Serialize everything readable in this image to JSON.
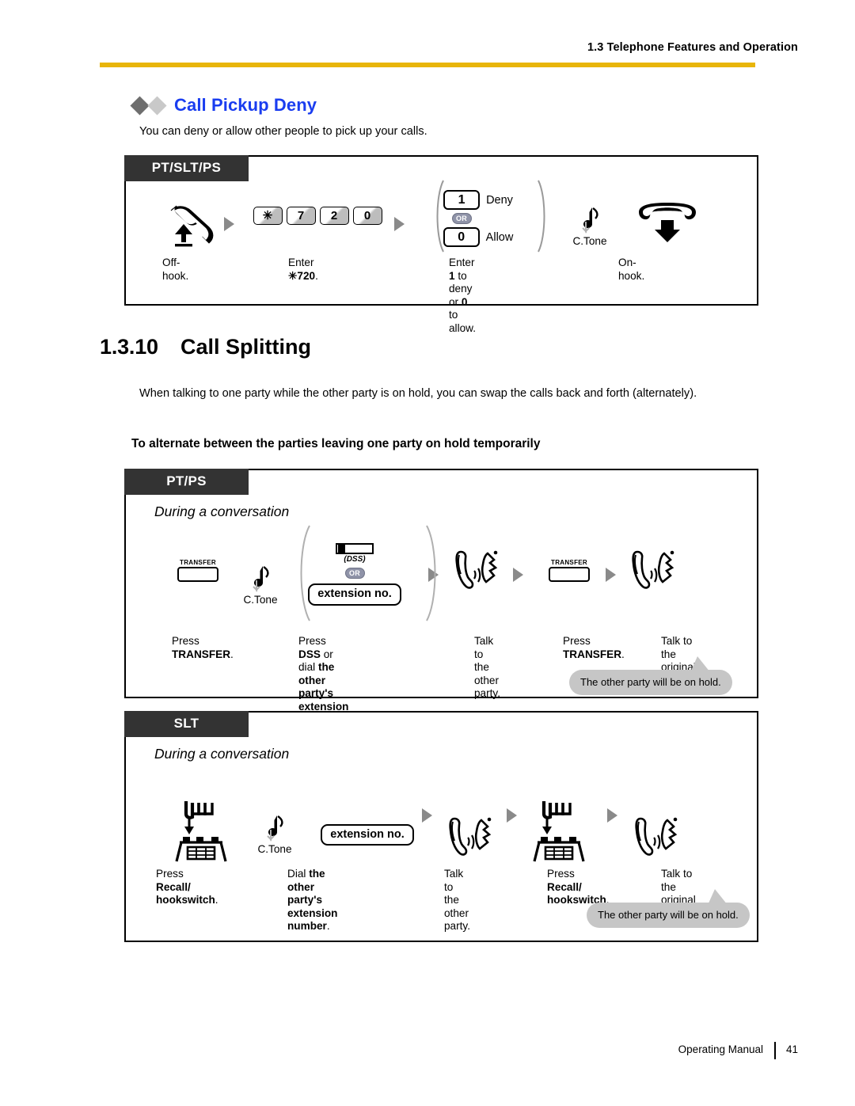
{
  "header": {
    "running_head": "1.3 Telephone Features and Operation",
    "rule_color": "#e8b50a"
  },
  "feature": {
    "title": "Call Pickup Deny",
    "title_color": "#1a3df0",
    "lead": "You can deny or allow other people to pick up your calls."
  },
  "box1": {
    "tab": "PT/SLT/PS",
    "steps": {
      "offhook_icon": "handset-offhook-icon",
      "keys": [
        "✳",
        "7",
        "2",
        "0"
      ],
      "or_badge": "OR",
      "key_deny": "1",
      "label_deny": "Deny",
      "key_allow": "0",
      "label_allow": "Allow",
      "ctone": "C.Tone",
      "onhook_icon": "handset-onhook-icon"
    },
    "captions": {
      "c1": "Off-hook.",
      "c2_pre": "Enter ",
      "c2_bold": "✳720",
      "c2_post": ".",
      "c3_line1_pre": "Enter ",
      "c3_line1_bold": "1",
      "c3_line1_post": " to deny",
      "c3_line2_pre": "or ",
      "c3_line2_bold": "0",
      "c3_line2_post": " to allow.",
      "c4": "On-hook."
    }
  },
  "section": {
    "number": "1.3.10",
    "name": "Call Splitting",
    "body": "When talking to one party while the other party is on hold, you can swap the calls back and forth (alternately).",
    "subhead": "To alternate between the parties leaving one party on hold temporarily"
  },
  "box2": {
    "tab": "PT/PS",
    "during": "During a conversation",
    "steps": {
      "transfer_label": "TRANSFER",
      "ctone": "C.Tone",
      "dss_label": "(DSS)",
      "or_badge": "OR",
      "extension_pill": "extension no.",
      "talk_icon": "handset-talking-icon"
    },
    "captions": [
      {
        "line1": "Press",
        "line2_bold": "TRANSFER",
        "line2_post": "."
      },
      {
        "line1_pre": "Press ",
        "line1_bold": "DSS",
        "line1_mid": " or dial ",
        "line1_bold2": "the other",
        "line2_bold": "party's extension number",
        "line2_post": "."
      },
      {
        "line1": "Talk to the",
        "line2": "other party."
      },
      {
        "line1": "Press",
        "line2_bold": "TRANSFER",
        "line2_post": "."
      },
      {
        "line1": "Talk to the",
        "line2": "original party."
      }
    ],
    "bubble": "The other party will be on hold."
  },
  "box3": {
    "tab": "SLT",
    "during": "During a conversation",
    "steps": {
      "hookswitch_icon": "hookswitch-icon",
      "ctone": "C.Tone",
      "extension_pill": "extension no.",
      "talk_icon": "handset-talking-icon"
    },
    "captions": [
      {
        "line1_pre": "Press ",
        "line1_bold": "Recall/",
        "line2_bold": "hookswitch",
        "line2_post": "."
      },
      {
        "line1_pre": "Dial ",
        "line1_bold": "the other party's",
        "line2_bold": "extension number",
        "line2_post": "."
      },
      {
        "line1": "Talk to the",
        "line2": "other party."
      },
      {
        "line1_pre": "Press ",
        "line1_bold": "Recall/",
        "line2_bold": "hookswitch",
        "line2_post": "."
      },
      {
        "line1": "Talk to the",
        "line2": "original party."
      }
    ],
    "bubble": "The other party will be on hold."
  },
  "footer": {
    "manual": "Operating Manual",
    "page": "41"
  }
}
